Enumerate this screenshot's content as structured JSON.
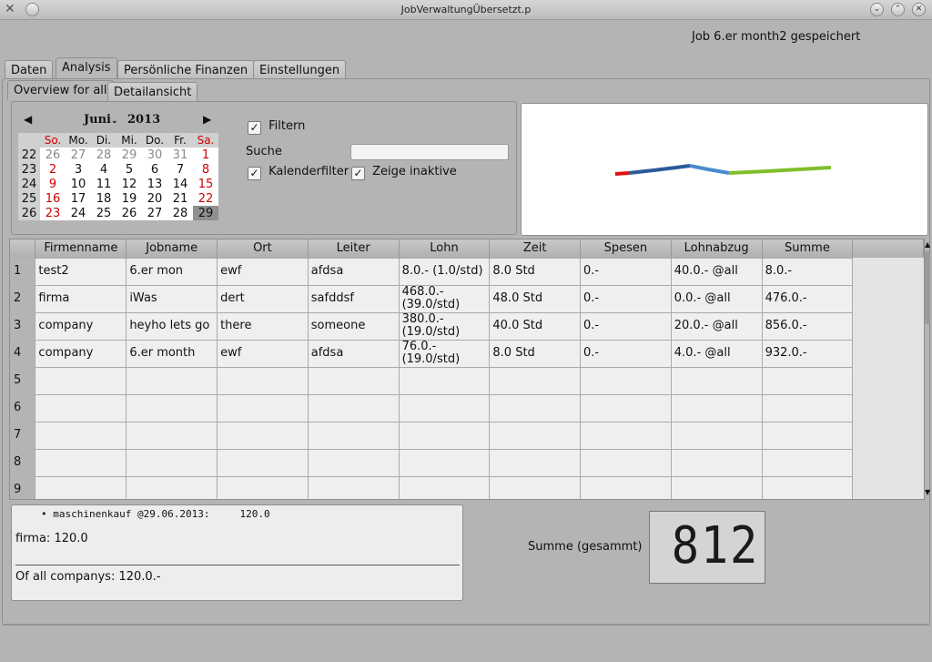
{
  "window": {
    "title": "JobVerwaltungÜbersetzt.p",
    "status": "Job 6.er month2 gespeichert"
  },
  "main_tabs": [
    "Daten",
    "Analysis",
    "Persönliche Finanzen",
    "Einstellungen"
  ],
  "sub_tabs": [
    "Overview for all",
    "Detailansicht"
  ],
  "calendar": {
    "month": "Juni",
    "year": "2013",
    "weekdays": [
      "So.",
      "Mo.",
      "Di.",
      "Mi.",
      "Do.",
      "Fr.",
      "Sa."
    ],
    "weeks": [
      {
        "wk": "22",
        "days": [
          "26",
          "27",
          "28",
          "29",
          "30",
          "31",
          "1"
        ]
      },
      {
        "wk": "23",
        "days": [
          "2",
          "3",
          "4",
          "5",
          "6",
          "7",
          "8"
        ]
      },
      {
        "wk": "24",
        "days": [
          "9",
          "10",
          "11",
          "12",
          "13",
          "14",
          "15"
        ]
      },
      {
        "wk": "25",
        "days": [
          "16",
          "17",
          "18",
          "19",
          "20",
          "21",
          "22"
        ]
      },
      {
        "wk": "26",
        "days": [
          "23",
          "24",
          "25",
          "26",
          "27",
          "28",
          "29"
        ]
      }
    ],
    "selected": "29"
  },
  "filters": {
    "filter_label": "Filtern",
    "search_label": "Suche",
    "search_value": "",
    "calendar_filter_label": "Kalenderfilter",
    "show_inactive_label": "Zeige inaktive"
  },
  "trend_colors": [
    "#e01010",
    "#2a5a9a",
    "#4a8ad0",
    "#7fbf2a"
  ],
  "table": {
    "headers": [
      "Firmenname",
      "Jobname",
      "Ort",
      "Leiter",
      "Lohn",
      "Zeit",
      "Spesen",
      "Lohnabzug",
      "Summe"
    ],
    "rows": [
      {
        "n": "1",
        "cells": [
          "test2",
          "6.er mon",
          "ewf",
          "afdsa",
          "8.0.- (1.0/std)",
          "8.0 Std",
          "0.-",
          "40.0.- @all",
          "8.0.-"
        ]
      },
      {
        "n": "2",
        "cells": [
          "firma",
          "iWas",
          "dert",
          "safddsf",
          "468.0.-\n(39.0/std)",
          "48.0 Std",
          "0.-",
          "0.0.- @all",
          "476.0.-"
        ]
      },
      {
        "n": "3",
        "cells": [
          "company",
          "heyho lets go",
          "there",
          "someone",
          "380.0.-\n(19.0/std)",
          "40.0 Std",
          "0.-",
          "20.0.- @all",
          "856.0.-"
        ]
      },
      {
        "n": "4",
        "cells": [
          "company",
          "6.er month",
          "ewf",
          "afdsa",
          "76.0.-\n(19.0/std)",
          "8.0 Std",
          "0.-",
          "4.0.- @all",
          "932.0.-"
        ]
      },
      {
        "n": "5",
        "cells": [
          "",
          "",
          "",
          "",
          "",
          "",
          "",
          "",
          ""
        ]
      },
      {
        "n": "6",
        "cells": [
          "",
          "",
          "",
          "",
          "",
          "",
          "",
          "",
          ""
        ]
      },
      {
        "n": "7",
        "cells": [
          "",
          "",
          "",
          "",
          "",
          "",
          "",
          "",
          ""
        ]
      },
      {
        "n": "8",
        "cells": [
          "",
          "",
          "",
          "",
          "",
          "",
          "",
          "",
          ""
        ]
      },
      {
        "n": "9",
        "cells": [
          "",
          "",
          "",
          "",
          "",
          "",
          "",
          "",
          ""
        ]
      }
    ]
  },
  "notes": {
    "item": "maschinenkauf @29.06.2013:     120.0",
    "firma": "firma: 120.0",
    "total": "Of all companys: 120.0.-"
  },
  "summary": {
    "label": "Summe (gesammt)",
    "value": "812"
  }
}
